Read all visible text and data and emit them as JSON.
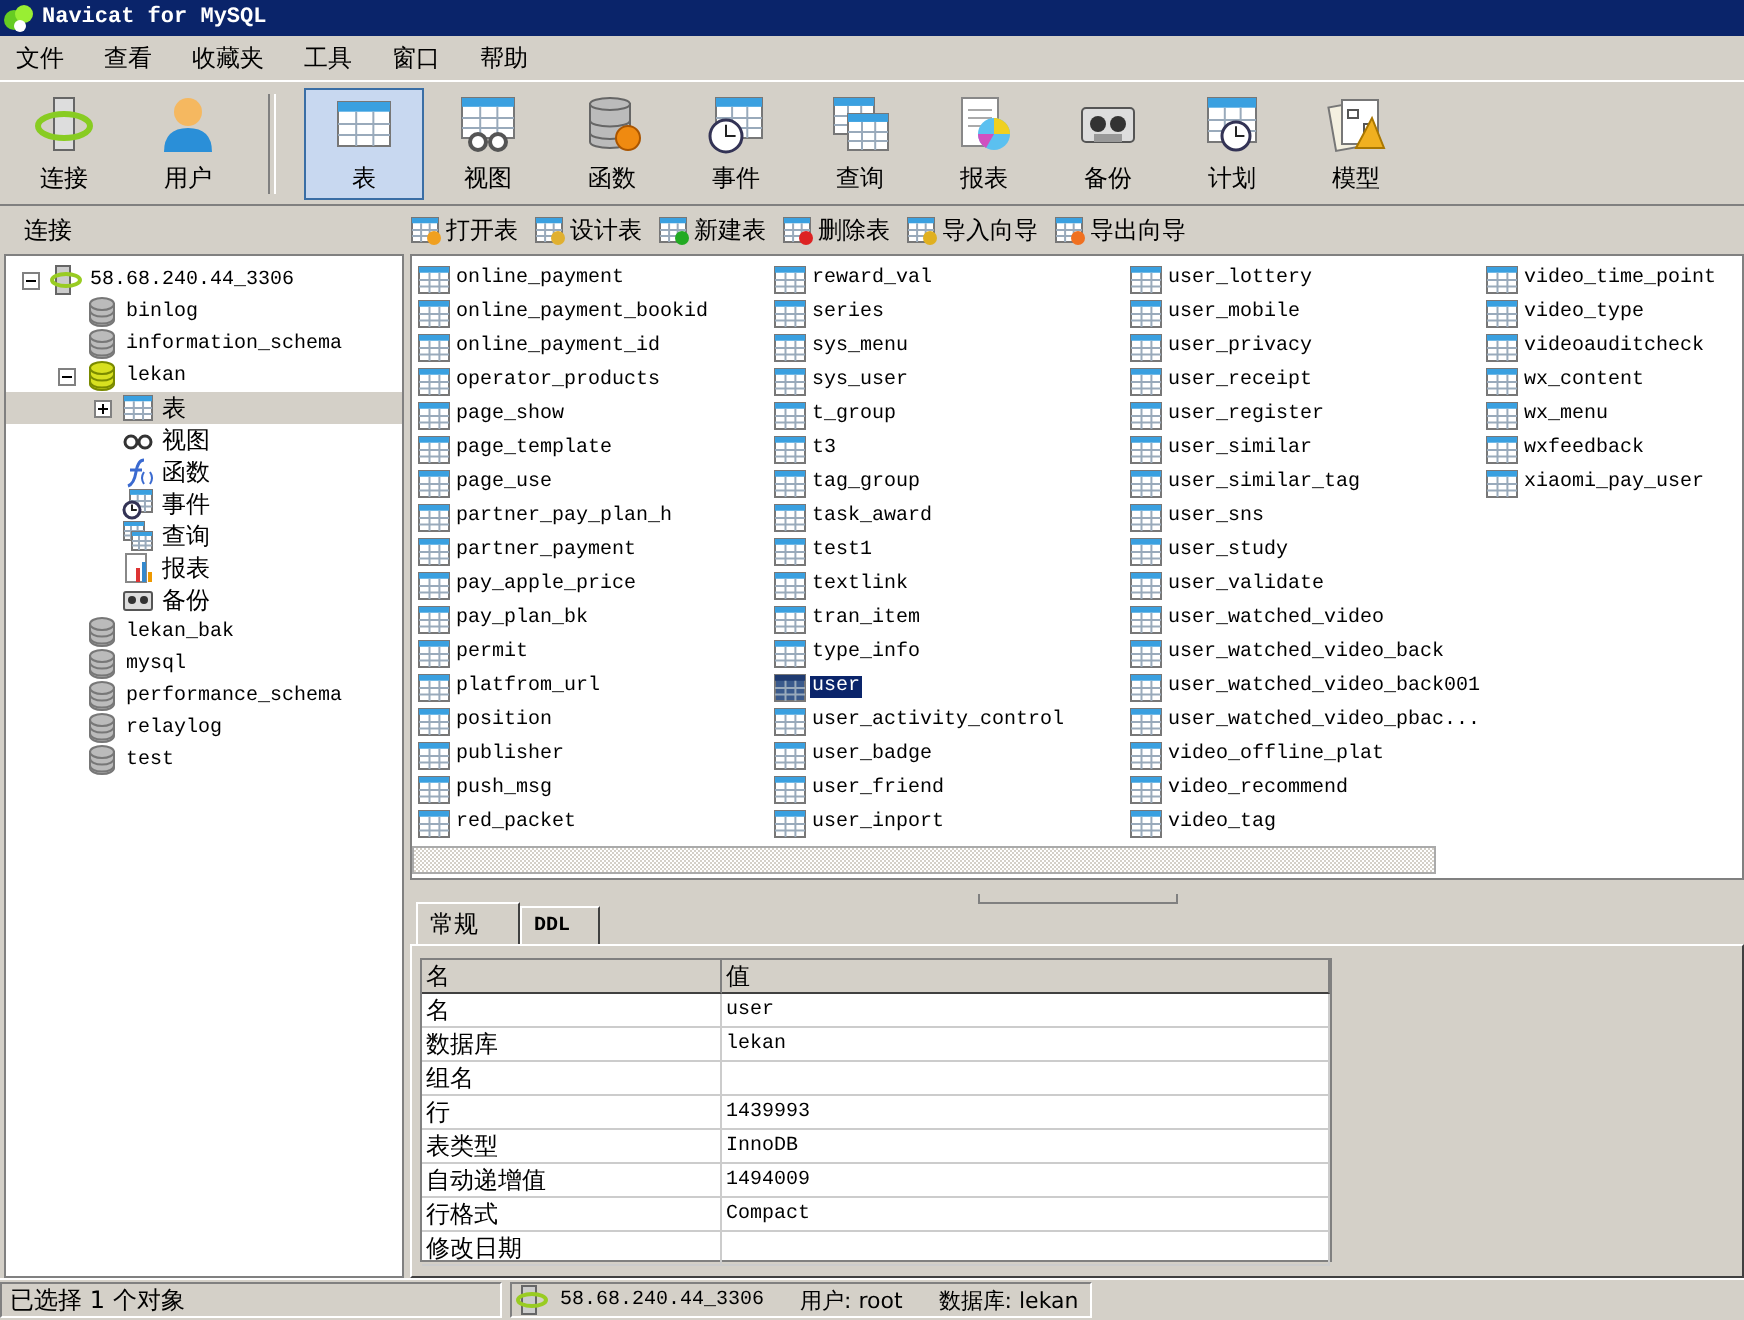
{
  "window": {
    "title": "Navicat for MySQL"
  },
  "menu": [
    "文件",
    "查看",
    "收藏夹",
    "工具",
    "窗口",
    "帮助"
  ],
  "toolbar": {
    "buttons": [
      {
        "label": "连接",
        "kind": "connect",
        "selected": false
      },
      {
        "label": "用户",
        "kind": "user",
        "selected": false
      },
      {
        "label": "表",
        "kind": "table",
        "selected": true
      },
      {
        "label": "视图",
        "kind": "view",
        "selected": false
      },
      {
        "label": "函数",
        "kind": "function",
        "selected": false
      },
      {
        "label": "事件",
        "kind": "event",
        "selected": false
      },
      {
        "label": "查询",
        "kind": "query",
        "selected": false
      },
      {
        "label": "报表",
        "kind": "report",
        "selected": false
      },
      {
        "label": "备份",
        "kind": "backup",
        "selected": false
      },
      {
        "label": "计划",
        "kind": "schedule",
        "selected": false
      },
      {
        "label": "模型",
        "kind": "model",
        "selected": false
      }
    ]
  },
  "sidebar_title": "连接",
  "object_toolbar": [
    {
      "label": "打开表",
      "kind": "open"
    },
    {
      "label": "设计表",
      "kind": "design"
    },
    {
      "label": "新建表",
      "kind": "new"
    },
    {
      "label": "删除表",
      "kind": "delete"
    },
    {
      "label": "导入向导",
      "kind": "import"
    },
    {
      "label": "导出向导",
      "kind": "export"
    }
  ],
  "tree": [
    {
      "label": "58.68.240.44_3306",
      "kind": "connection",
      "expanded": true,
      "selected": false,
      "children": [
        {
          "label": "binlog",
          "kind": "database",
          "open": false,
          "selected": false
        },
        {
          "label": "information_schema",
          "kind": "database",
          "open": false,
          "selected": false
        },
        {
          "label": "lekan",
          "kind": "database",
          "open": true,
          "expanded": true,
          "selected": false,
          "children": [
            {
              "label": "表",
              "kind": "tables",
              "expanded": false,
              "selected": true
            },
            {
              "label": "视图",
              "kind": "views",
              "selected": false
            },
            {
              "label": "函数",
              "kind": "functions",
              "selected": false
            },
            {
              "label": "事件",
              "kind": "events",
              "selected": false
            },
            {
              "label": "查询",
              "kind": "queries",
              "selected": false
            },
            {
              "label": "报表",
              "kind": "reports",
              "selected": false
            },
            {
              "label": "备份",
              "kind": "backups",
              "selected": false
            }
          ]
        },
        {
          "label": "lekan_bak",
          "kind": "database",
          "open": false,
          "selected": false
        },
        {
          "label": "mysql",
          "kind": "database",
          "open": false,
          "selected": false
        },
        {
          "label": "performance_schema",
          "kind": "database",
          "open": false,
          "selected": false
        },
        {
          "label": "relaylog",
          "kind": "database",
          "open": false,
          "selected": false
        },
        {
          "label": "test",
          "kind": "database",
          "open": false,
          "selected": false
        }
      ]
    }
  ],
  "tables": [
    {
      "name": "online_payment",
      "selected": false
    },
    {
      "name": "online_payment_bookid",
      "selected": false
    },
    {
      "name": "online_payment_id",
      "selected": false
    },
    {
      "name": "operator_products",
      "selected": false
    },
    {
      "name": "page_show",
      "selected": false
    },
    {
      "name": "page_template",
      "selected": false
    },
    {
      "name": "page_use",
      "selected": false
    },
    {
      "name": "partner_pay_plan_h",
      "selected": false
    },
    {
      "name": "partner_payment",
      "selected": false
    },
    {
      "name": "pay_apple_price",
      "selected": false
    },
    {
      "name": "pay_plan_bk",
      "selected": false
    },
    {
      "name": "permit",
      "selected": false
    },
    {
      "name": "platfrom_url",
      "selected": false
    },
    {
      "name": "position",
      "selected": false
    },
    {
      "name": "publisher",
      "selected": false
    },
    {
      "name": "push_msg",
      "selected": false
    },
    {
      "name": "red_packet",
      "selected": false
    },
    {
      "name": "reward_val",
      "selected": false
    },
    {
      "name": "series",
      "selected": false
    },
    {
      "name": "sys_menu",
      "selected": false
    },
    {
      "name": "sys_user",
      "selected": false
    },
    {
      "name": "t_group",
      "selected": false
    },
    {
      "name": "t3",
      "selected": false
    },
    {
      "name": "tag_group",
      "selected": false
    },
    {
      "name": "task_award",
      "selected": false
    },
    {
      "name": "test1",
      "selected": false
    },
    {
      "name": "textlink",
      "selected": false
    },
    {
      "name": "tran_item",
      "selected": false
    },
    {
      "name": "type_info",
      "selected": false
    },
    {
      "name": "user",
      "selected": true
    },
    {
      "name": "user_activity_control",
      "selected": false
    },
    {
      "name": "user_badge",
      "selected": false
    },
    {
      "name": "user_friend",
      "selected": false
    },
    {
      "name": "user_inport",
      "selected": false
    },
    {
      "name": "user_lottery",
      "selected": false
    },
    {
      "name": "user_mobile",
      "selected": false
    },
    {
      "name": "user_privacy",
      "selected": false
    },
    {
      "name": "user_receipt",
      "selected": false
    },
    {
      "name": "user_register",
      "selected": false
    },
    {
      "name": "user_similar",
      "selected": false
    },
    {
      "name": "user_similar_tag",
      "selected": false
    },
    {
      "name": "user_sns",
      "selected": false
    },
    {
      "name": "user_study",
      "selected": false
    },
    {
      "name": "user_validate",
      "selected": false
    },
    {
      "name": "user_watched_video",
      "selected": false
    },
    {
      "name": "user_watched_video_back",
      "selected": false
    },
    {
      "name": "user_watched_video_back001",
      "selected": false
    },
    {
      "name": "user_watched_video_pbac...",
      "selected": false
    },
    {
      "name": "video_offline_plat",
      "selected": false
    },
    {
      "name": "video_recommend",
      "selected": false
    },
    {
      "name": "video_tag",
      "selected": false
    },
    {
      "name": "video_time_point",
      "selected": false
    },
    {
      "name": "video_type",
      "selected": false
    },
    {
      "name": "videoauditcheck",
      "selected": false
    },
    {
      "name": "wx_content",
      "selected": false
    },
    {
      "name": "wx_menu",
      "selected": false
    },
    {
      "name": "wxfeedback",
      "selected": false
    },
    {
      "name": "xiaomi_pay_user",
      "selected": false
    }
  ],
  "details": {
    "tabs": [
      {
        "label": "常规",
        "selected": true
      },
      {
        "label": "DDL",
        "selected": false
      }
    ],
    "columns": [
      "名",
      "值"
    ],
    "rows": [
      {
        "name": "名",
        "value": "user"
      },
      {
        "name": "数据库",
        "value": "lekan"
      },
      {
        "name": "组名"
      },
      {
        "name": "行",
        "value": "1439993"
      },
      {
        "name": "表类型",
        "value": "InnoDB"
      },
      {
        "name": "自动递增值",
        "value": "1494009"
      },
      {
        "name": "行格式",
        "value": "Compact"
      },
      {
        "name": "修改日期"
      }
    ]
  },
  "status_bar": {
    "selection": "已选择 1 个对象",
    "connection": "58.68.240.44_3306",
    "user": "用户: root",
    "database": "数据库: lekan"
  }
}
